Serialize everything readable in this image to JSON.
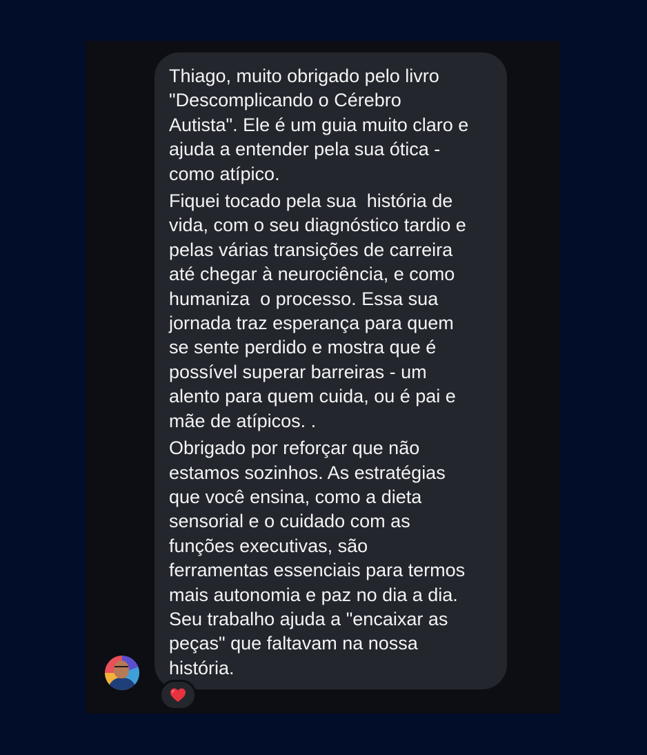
{
  "message": {
    "paragraphs": [
      {
        "lines": [
          "Thiago, muito obrigado pelo livro",
          "\"Descomplicando o Cérebro",
          "Autista\". Ele é um guia muito claro e",
          "ajuda a entender pela sua ótica -",
          "como atípico."
        ]
      },
      {
        "lines": [
          "Fiquei tocado pela sua  história de",
          "vida, com o seu diagnóstico tardio e",
          "pelas várias transições de carreira",
          "até chegar à neurociência, e como",
          "humaniza  o processo. Essa sua",
          "jornada traz esperança para quem",
          "se sente perdido e mostra que é",
          "possível superar barreiras - um",
          "alento para quem cuida, ou é pai e",
          "mãe de atípicos. ."
        ]
      },
      {
        "lines": [
          "Obrigado por reforçar que não",
          "estamos sozinhos. As estratégias",
          "que você ensina, como a dieta",
          "sensorial e o cuidado com as",
          "funções executivas, são",
          "ferramentas essenciais para termos",
          "mais autonomia e paz no dia a dia.",
          "Seu trabalho ajuda a \"encaixar as",
          "peças\" que faltavam na nossa",
          "história."
        ]
      }
    ]
  },
  "reaction": {
    "icon": "heart-icon",
    "color": "#e8333f"
  },
  "avatar": {
    "icon": "avatar"
  },
  "colors": {
    "background": "#020d2a",
    "panel": "#0c0e14",
    "bubble": "#23262d",
    "text": "#f4f4f5"
  }
}
